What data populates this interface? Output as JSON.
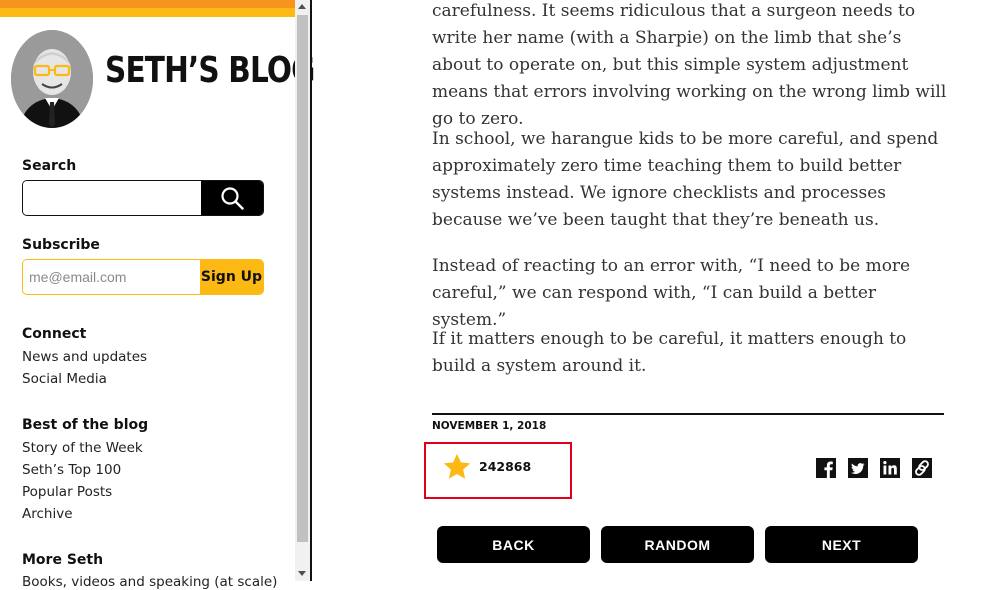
{
  "brand": {
    "title": "SETH’S BLOG"
  },
  "sidebar": {
    "search": {
      "label": "Search",
      "placeholder": ""
    },
    "subscribe": {
      "label": "Subscribe",
      "placeholder": "me@email.com",
      "button": "Sign Up"
    },
    "connect": {
      "label": "Connect",
      "links": [
        "News and updates",
        "Social Media"
      ]
    },
    "best": {
      "label": "Best of the blog",
      "links": [
        "Story of the Week",
        "Seth’s Top 100",
        "Popular Posts",
        "Archive"
      ]
    },
    "more": {
      "label": "More Seth",
      "partial_link": "Books, videos and speaking (at scale)"
    }
  },
  "article": {
    "paragraphs": [
      "carefulness. It seems ridiculous that a surgeon needs to write her name (with a Sharpie) on the limb that she’s about to operate on, but this simple system adjustment means that errors involving working on the wrong limb will go to zero.",
      "In school, we harangue kids to be more careful, and spend approximately zero time teaching them to build better systems instead. We ignore checklists and processes because we’ve been taught that they’re beneath us.",
      "Instead of reacting to an error with, “I need to be more careful,” we can respond with, “I can build a better system.”",
      "If it matters enough to be careful, it matters enough to build a system around it."
    ],
    "date": "NOVEMBER 1, 2018",
    "star_count": "242868"
  },
  "nav": {
    "back": "BACK",
    "random": "RANDOM",
    "next": "NEXT"
  },
  "colors": {
    "orange": "#f7941d",
    "yellow": "#fdb913",
    "star": "#fdb913",
    "highlight": "#e0001b"
  },
  "icons": [
    "search-icon",
    "star-icon",
    "facebook-icon",
    "twitter-icon",
    "linkedin-icon",
    "link-icon"
  ]
}
